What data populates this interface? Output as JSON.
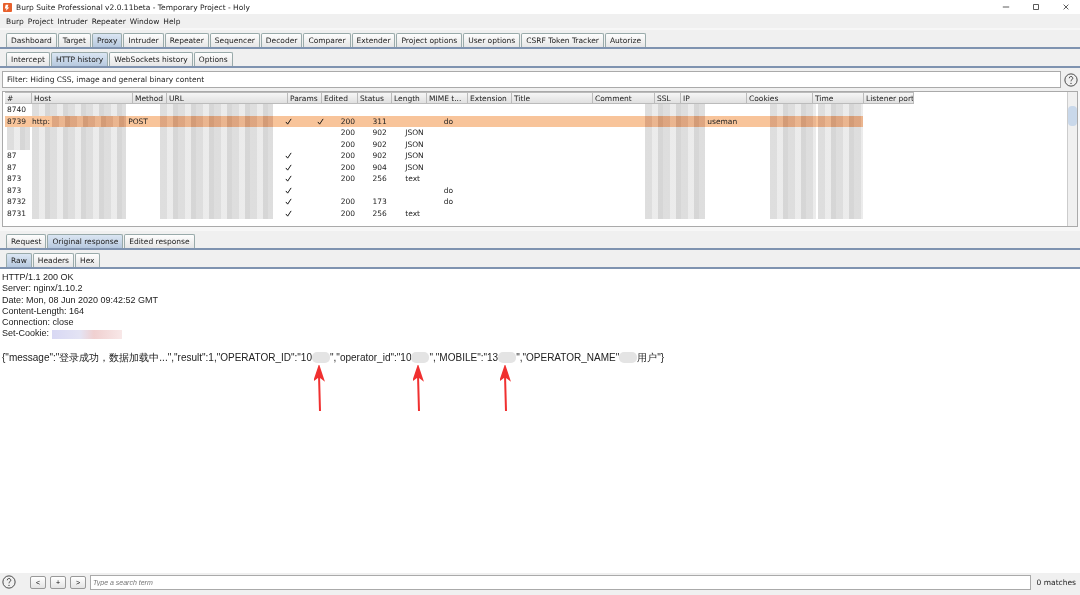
{
  "window": {
    "title": "Burp Suite Professional v2.0.11beta - Temporary Project - Holy"
  },
  "menu": [
    "Burp",
    "Project",
    "Intruder",
    "Repeater",
    "Window",
    "Help"
  ],
  "main_tabs": [
    {
      "label": "Dashboard",
      "selected": false
    },
    {
      "label": "Target",
      "selected": false
    },
    {
      "label": "Proxy",
      "selected": true
    },
    {
      "label": "Intruder",
      "selected": false
    },
    {
      "label": "Repeater",
      "selected": false
    },
    {
      "label": "Sequencer",
      "selected": false
    },
    {
      "label": "Decoder",
      "selected": false
    },
    {
      "label": "Comparer",
      "selected": false
    },
    {
      "label": "Extender",
      "selected": false
    },
    {
      "label": "Project options",
      "selected": false
    },
    {
      "label": "User options",
      "selected": false
    },
    {
      "label": "CSRF Token Tracker",
      "selected": false
    },
    {
      "label": "Autorize",
      "selected": false
    }
  ],
  "proxy_tabs": [
    {
      "label": "Intercept",
      "selected": false
    },
    {
      "label": "HTTP history",
      "selected": true
    },
    {
      "label": "WebSockets history",
      "selected": false
    },
    {
      "label": "Options",
      "selected": false
    }
  ],
  "filter": "Filter: Hiding CSS, image and general binary content",
  "table": {
    "columns": [
      "#",
      "Host",
      "Method",
      "URL",
      "Params",
      "Edited",
      "Status",
      "Length",
      "MIME t...",
      "Extension",
      "Title",
      "Comment",
      "SSL",
      "IP",
      "Cookies",
      "Time",
      "Listener port"
    ],
    "rows": [
      {
        "number": "8740",
        "params": false,
        "edited": false,
        "selected": false
      },
      {
        "number": "8739",
        "host": "http:",
        "method": "POST",
        "params": true,
        "edited": true,
        "status": "200",
        "length": "311",
        "extension": "do",
        "cookies": "useman",
        "selected": true
      },
      {
        "params": false,
        "edited": false,
        "status": "200",
        "length": "902",
        "mime": "JSON",
        "selected": false
      },
      {
        "params": false,
        "edited": false,
        "status": "200",
        "length": "902",
        "mime": "JSON",
        "selected": false
      },
      {
        "number": "87",
        "params": true,
        "edited": false,
        "status": "200",
        "length": "902",
        "mime": "JSON",
        "selected": false
      },
      {
        "number": "87",
        "params": true,
        "edited": false,
        "status": "200",
        "length": "904",
        "mime": "JSON",
        "selected": false
      },
      {
        "number": "873",
        "params": true,
        "edited": false,
        "status": "200",
        "length": "256",
        "mime": "text",
        "selected": false
      },
      {
        "number": "873",
        "params": true,
        "edited": false,
        "extension": "do",
        "selected": false
      },
      {
        "number": "8732",
        "params": true,
        "edited": false,
        "status": "200",
        "length": "173",
        "extension": "do",
        "selected": false
      },
      {
        "number": "8731",
        "params": true,
        "edited": false,
        "status": "200",
        "length": "256",
        "mime": "text",
        "selected": false
      }
    ]
  },
  "message_tabs": [
    {
      "label": "Request",
      "selected": false
    },
    {
      "label": "Original response",
      "selected": true
    },
    {
      "label": "Edited response",
      "selected": false
    }
  ],
  "view_tabs": [
    {
      "label": "Raw",
      "selected": true
    },
    {
      "label": "Headers",
      "selected": false
    },
    {
      "label": "Hex",
      "selected": false
    }
  ],
  "response_lines": [
    "HTTP/1.1 200 OK",
    "Server: nginx/1.10.2",
    "Date: Mon, 08 Jun 2020 09:42:52 GMT",
    "Content-Length: 164",
    "Connection: close",
    "Set-Cookie:"
  ],
  "response_body": [
    {
      "kind": "text",
      "text": "{\"message\":\"登录成功，数据加载中...\",\"result\":1,\"OPERATOR_ID\":\"10"
    },
    {
      "kind": "redacted",
      "arrow": true
    },
    {
      "kind": "text",
      "text": "\",\"operator_id\":\"10"
    },
    {
      "kind": "redacted",
      "arrow": true
    },
    {
      "kind": "text",
      "text": "\",\"MOBILE\":\"13"
    },
    {
      "kind": "redacted",
      "arrow": true
    },
    {
      "kind": "text",
      "text": "\",\"OPERATOR_NAME\""
    },
    {
      "kind": "redacted",
      "arrow": false
    },
    {
      "kind": "text",
      "text": "用户\"}"
    }
  ],
  "search": {
    "buttons": [
      "<",
      "+",
      ">"
    ],
    "placeholder": "Type a search term",
    "matches": "0 matches"
  }
}
